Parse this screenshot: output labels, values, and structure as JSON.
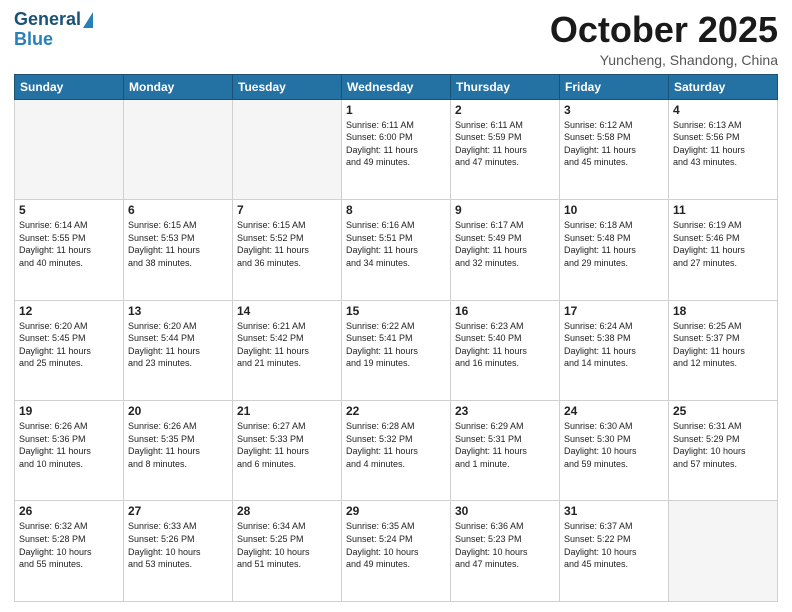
{
  "header": {
    "logo_line1": "General",
    "logo_line2": "Blue",
    "month": "October 2025",
    "location": "Yuncheng, Shandong, China"
  },
  "days_of_week": [
    "Sunday",
    "Monday",
    "Tuesday",
    "Wednesday",
    "Thursday",
    "Friday",
    "Saturday"
  ],
  "weeks": [
    [
      {
        "day": "",
        "info": ""
      },
      {
        "day": "",
        "info": ""
      },
      {
        "day": "",
        "info": ""
      },
      {
        "day": "1",
        "info": "Sunrise: 6:11 AM\nSunset: 6:00 PM\nDaylight: 11 hours\nand 49 minutes."
      },
      {
        "day": "2",
        "info": "Sunrise: 6:11 AM\nSunset: 5:59 PM\nDaylight: 11 hours\nand 47 minutes."
      },
      {
        "day": "3",
        "info": "Sunrise: 6:12 AM\nSunset: 5:58 PM\nDaylight: 11 hours\nand 45 minutes."
      },
      {
        "day": "4",
        "info": "Sunrise: 6:13 AM\nSunset: 5:56 PM\nDaylight: 11 hours\nand 43 minutes."
      }
    ],
    [
      {
        "day": "5",
        "info": "Sunrise: 6:14 AM\nSunset: 5:55 PM\nDaylight: 11 hours\nand 40 minutes."
      },
      {
        "day": "6",
        "info": "Sunrise: 6:15 AM\nSunset: 5:53 PM\nDaylight: 11 hours\nand 38 minutes."
      },
      {
        "day": "7",
        "info": "Sunrise: 6:15 AM\nSunset: 5:52 PM\nDaylight: 11 hours\nand 36 minutes."
      },
      {
        "day": "8",
        "info": "Sunrise: 6:16 AM\nSunset: 5:51 PM\nDaylight: 11 hours\nand 34 minutes."
      },
      {
        "day": "9",
        "info": "Sunrise: 6:17 AM\nSunset: 5:49 PM\nDaylight: 11 hours\nand 32 minutes."
      },
      {
        "day": "10",
        "info": "Sunrise: 6:18 AM\nSunset: 5:48 PM\nDaylight: 11 hours\nand 29 minutes."
      },
      {
        "day": "11",
        "info": "Sunrise: 6:19 AM\nSunset: 5:46 PM\nDaylight: 11 hours\nand 27 minutes."
      }
    ],
    [
      {
        "day": "12",
        "info": "Sunrise: 6:20 AM\nSunset: 5:45 PM\nDaylight: 11 hours\nand 25 minutes."
      },
      {
        "day": "13",
        "info": "Sunrise: 6:20 AM\nSunset: 5:44 PM\nDaylight: 11 hours\nand 23 minutes."
      },
      {
        "day": "14",
        "info": "Sunrise: 6:21 AM\nSunset: 5:42 PM\nDaylight: 11 hours\nand 21 minutes."
      },
      {
        "day": "15",
        "info": "Sunrise: 6:22 AM\nSunset: 5:41 PM\nDaylight: 11 hours\nand 19 minutes."
      },
      {
        "day": "16",
        "info": "Sunrise: 6:23 AM\nSunset: 5:40 PM\nDaylight: 11 hours\nand 16 minutes."
      },
      {
        "day": "17",
        "info": "Sunrise: 6:24 AM\nSunset: 5:38 PM\nDaylight: 11 hours\nand 14 minutes."
      },
      {
        "day": "18",
        "info": "Sunrise: 6:25 AM\nSunset: 5:37 PM\nDaylight: 11 hours\nand 12 minutes."
      }
    ],
    [
      {
        "day": "19",
        "info": "Sunrise: 6:26 AM\nSunset: 5:36 PM\nDaylight: 11 hours\nand 10 minutes."
      },
      {
        "day": "20",
        "info": "Sunrise: 6:26 AM\nSunset: 5:35 PM\nDaylight: 11 hours\nand 8 minutes."
      },
      {
        "day": "21",
        "info": "Sunrise: 6:27 AM\nSunset: 5:33 PM\nDaylight: 11 hours\nand 6 minutes."
      },
      {
        "day": "22",
        "info": "Sunrise: 6:28 AM\nSunset: 5:32 PM\nDaylight: 11 hours\nand 4 minutes."
      },
      {
        "day": "23",
        "info": "Sunrise: 6:29 AM\nSunset: 5:31 PM\nDaylight: 11 hours\nand 1 minute."
      },
      {
        "day": "24",
        "info": "Sunrise: 6:30 AM\nSunset: 5:30 PM\nDaylight: 10 hours\nand 59 minutes."
      },
      {
        "day": "25",
        "info": "Sunrise: 6:31 AM\nSunset: 5:29 PM\nDaylight: 10 hours\nand 57 minutes."
      }
    ],
    [
      {
        "day": "26",
        "info": "Sunrise: 6:32 AM\nSunset: 5:28 PM\nDaylight: 10 hours\nand 55 minutes."
      },
      {
        "day": "27",
        "info": "Sunrise: 6:33 AM\nSunset: 5:26 PM\nDaylight: 10 hours\nand 53 minutes."
      },
      {
        "day": "28",
        "info": "Sunrise: 6:34 AM\nSunset: 5:25 PM\nDaylight: 10 hours\nand 51 minutes."
      },
      {
        "day": "29",
        "info": "Sunrise: 6:35 AM\nSunset: 5:24 PM\nDaylight: 10 hours\nand 49 minutes."
      },
      {
        "day": "30",
        "info": "Sunrise: 6:36 AM\nSunset: 5:23 PM\nDaylight: 10 hours\nand 47 minutes."
      },
      {
        "day": "31",
        "info": "Sunrise: 6:37 AM\nSunset: 5:22 PM\nDaylight: 10 hours\nand 45 minutes."
      },
      {
        "day": "",
        "info": ""
      }
    ]
  ]
}
